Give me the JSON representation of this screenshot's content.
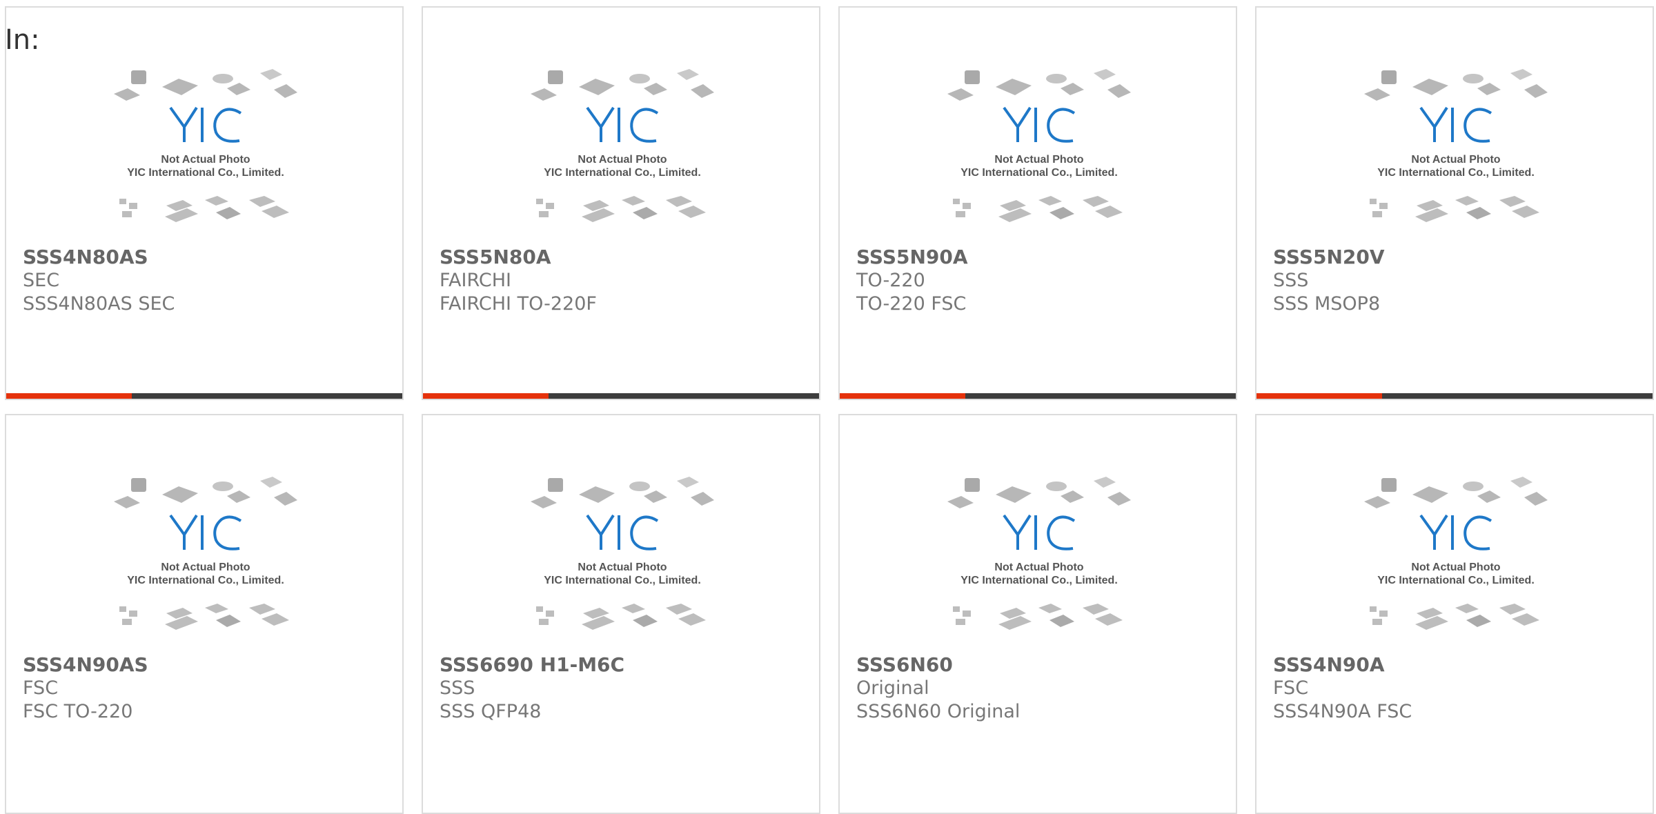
{
  "header": {
    "label": "In:"
  },
  "placeholder": {
    "caption1": "Not Actual Photo",
    "caption2": "YIC International Co., Limited.",
    "logo_text": "YIC"
  },
  "colors": {
    "accent": "#e5320c",
    "bar": "#3d3d3d",
    "logo_blue": "#1e78c8",
    "chip_gray": "#b5b5b5"
  },
  "products": [
    {
      "part": "SSS4N80AS",
      "line1": "SEC",
      "line2": "SSS4N80AS SEC"
    },
    {
      "part": "SSS5N80A",
      "line1": "FAIRCHI",
      "line2": "FAIRCHI TO-220F"
    },
    {
      "part": "SSS5N90A",
      "line1": "TO-220",
      "line2": "TO-220 FSC"
    },
    {
      "part": "SSS5N20V",
      "line1": "SSS",
      "line2": "SSS MSOP8"
    },
    {
      "part": "SSS4N90AS",
      "line1": "FSC",
      "line2": "FSC TO-220"
    },
    {
      "part": "SSS6690 H1-M6C",
      "line1": "SSS",
      "line2": "SSS QFP48"
    },
    {
      "part": "SSS6N60",
      "line1": "Original",
      "line2": "SSS6N60 Original"
    },
    {
      "part": "SSS4N90A",
      "line1": "FSC",
      "line2": "SSS4N90A FSC"
    }
  ]
}
